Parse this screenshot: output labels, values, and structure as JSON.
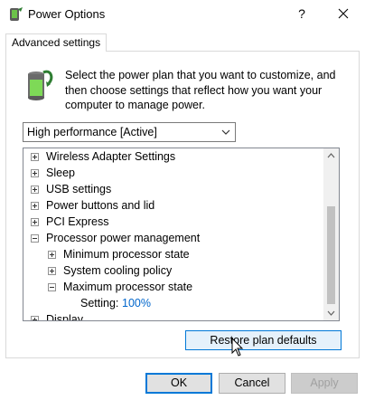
{
  "window": {
    "title": "Power Options",
    "help_label": "?"
  },
  "tab": {
    "label": "Advanced settings"
  },
  "description": "Select the power plan that you want to customize, and then choose settings that reflect how you want your computer to manage power.",
  "plan_select": {
    "value": "High performance [Active]"
  },
  "tree": {
    "items": [
      {
        "label": "Wireless Adapter Settings",
        "expander": "plus"
      },
      {
        "label": "Sleep",
        "expander": "plus"
      },
      {
        "label": "USB settings",
        "expander": "plus"
      },
      {
        "label": "Power buttons and lid",
        "expander": "plus"
      },
      {
        "label": "PCI Express",
        "expander": "plus"
      },
      {
        "label": "Processor power management",
        "expander": "minus"
      },
      {
        "label": "Minimum processor state",
        "expander": "plus"
      },
      {
        "label": "System cooling policy",
        "expander": "plus"
      },
      {
        "label": "Maximum processor state",
        "expander": "minus"
      },
      {
        "label": "Setting:",
        "value": "100%"
      },
      {
        "label": "Display",
        "expander": "plus"
      }
    ]
  },
  "restore_button": {
    "label": "Restore plan defaults"
  },
  "buttons": {
    "ok": "OK",
    "cancel": "Cancel",
    "apply": "Apply"
  },
  "colors": {
    "accent": "#0078d7",
    "setting_value": "#0066cc"
  }
}
